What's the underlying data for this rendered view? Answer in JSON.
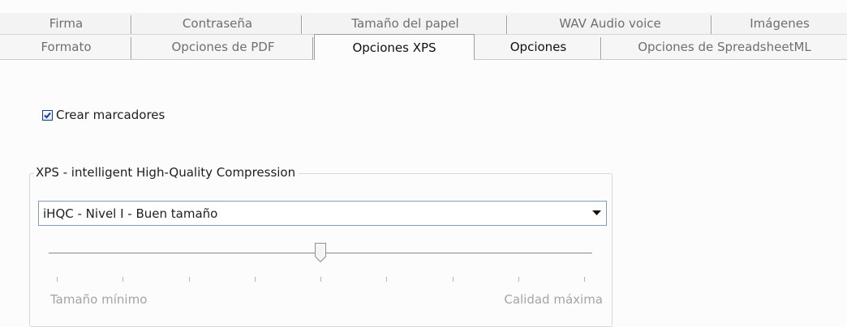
{
  "tabs_back_row": [
    {
      "label": "Firma"
    },
    {
      "label": "Contraseña"
    },
    {
      "label": "Tamaño del papel"
    },
    {
      "label": "WAV Audio voice"
    },
    {
      "label": "Imágenes"
    }
  ],
  "tabs_front_row": [
    {
      "label": "Formato"
    },
    {
      "label": "Opciones de PDF"
    },
    {
      "label": "Opciones XPS"
    },
    {
      "label": "Opciones"
    },
    {
      "label": "Opciones de SpreadsheetML"
    }
  ],
  "active_tab": "Opciones XPS",
  "bookmarks_checkbox": {
    "label": "Crear marcadores",
    "checked": true
  },
  "compression_group": {
    "title": "XPS - intelligent High-Quality Compression",
    "dropdown_value": "iHQC - Nivel I - Buen tamaño",
    "slider": {
      "tick_count": 9,
      "position_index": 4,
      "min_label": "Tamaño mínimo",
      "max_label": "Calidad máxima",
      "enabled": false
    }
  },
  "icons": {
    "checkbox_check": "checkmark-icon",
    "dropdown_arrow": "chevron-down-icon",
    "slider_thumb": "slider-thumb-icon"
  },
  "colors": {
    "checkbox_check": "#1b3f8f",
    "disabled_text": "#a4a4a4"
  }
}
